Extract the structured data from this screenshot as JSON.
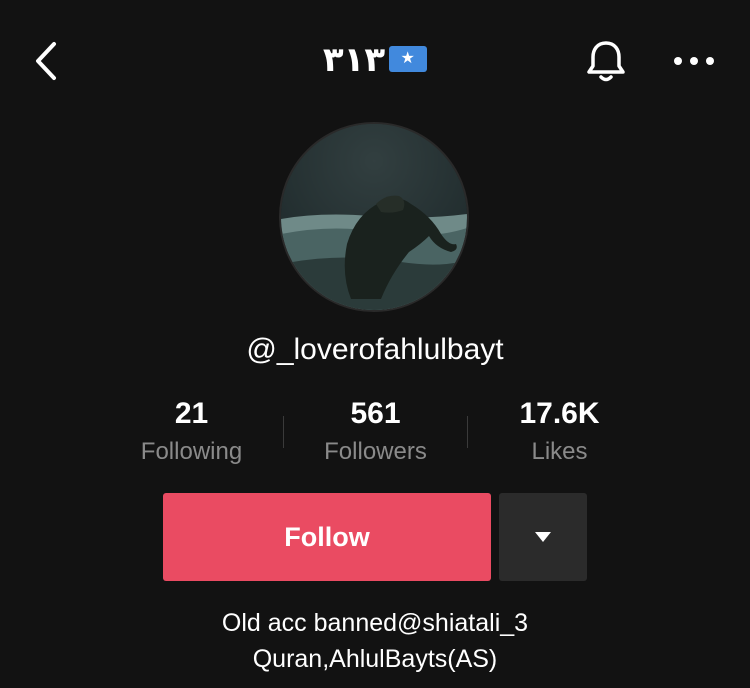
{
  "header": {
    "title": "٣١٣",
    "flag_star": "★",
    "flag_color": "#4189dd"
  },
  "profile": {
    "username": "@_loverofahlulbayt",
    "stats": [
      {
        "value": "21",
        "label": "Following"
      },
      {
        "value": "561",
        "label": "Followers"
      },
      {
        "value": "17.6K",
        "label": "Likes"
      }
    ]
  },
  "actions": {
    "follow_label": "Follow",
    "follow_color": "#ea4b62"
  },
  "bio": {
    "lines": [
      "Old acc banned@shiatali_3",
      "Quran,AhlulBayts(AS)"
    ]
  },
  "icons": {
    "back": "chevron-left-icon",
    "bell": "bell-icon",
    "more": "more-dots-icon",
    "dropdown": "caret-down-icon"
  }
}
